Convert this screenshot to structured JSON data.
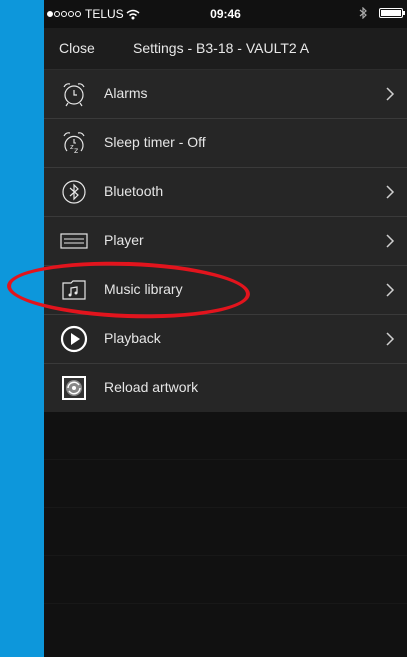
{
  "status_bar": {
    "carrier": "TELUS",
    "time": "09:46"
  },
  "nav": {
    "close_label": "Close",
    "title": "Settings - B3-18 - VAULT2 A"
  },
  "menu": [
    {
      "label": "Alarms",
      "icon": "alarm-clock-icon",
      "has_chevron": true
    },
    {
      "label": "Sleep timer - Off",
      "icon": "sleep-timer-icon",
      "has_chevron": false
    },
    {
      "label": "Bluetooth",
      "icon": "bluetooth-icon",
      "has_chevron": true
    },
    {
      "label": "Player",
      "icon": "player-device-icon",
      "has_chevron": true
    },
    {
      "label": "Music library",
      "icon": "music-folder-icon",
      "has_chevron": true
    },
    {
      "label": "Playback",
      "icon": "play-circle-icon",
      "has_chevron": true
    },
    {
      "label": "Reload artwork",
      "icon": "reload-artwork-icon",
      "has_chevron": false
    }
  ],
  "colors": {
    "background_accent": "#0d97db",
    "highlight_annotation": "#e2141d"
  }
}
